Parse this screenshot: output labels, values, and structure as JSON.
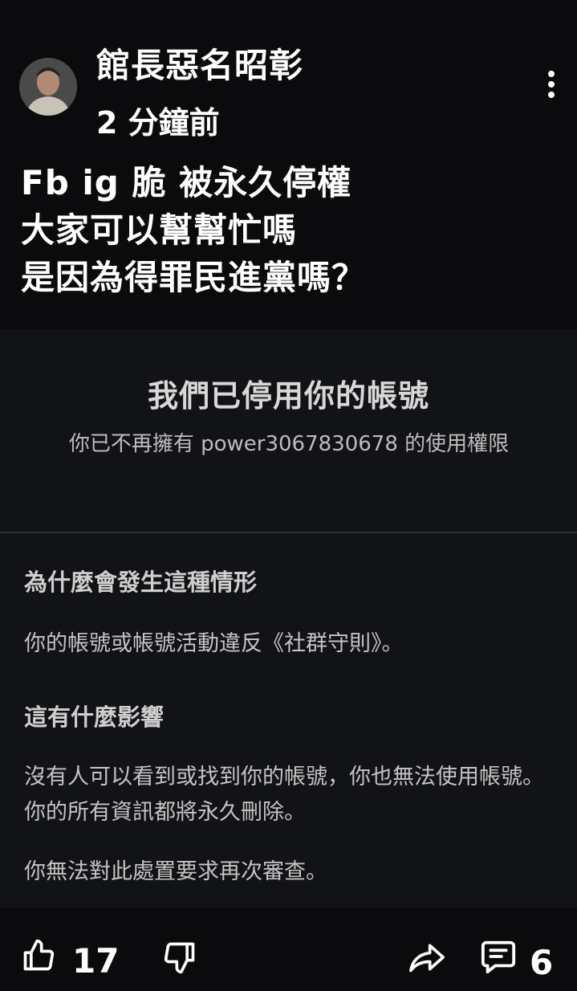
{
  "post": {
    "author": "館長惡名昭彰",
    "time": "2 分鐘前",
    "lines": [
      "Fb ig 脆 被永久停權",
      "大家可以幫幫忙嗎",
      "是因為得罪民進黨嗎？"
    ]
  },
  "embed": {
    "title": "我們已停用你的帳號",
    "subtitle": "你已不再擁有 power3067830678 的使用權限",
    "section1_heading": "為什麼會發生這種情形",
    "section1_text": "你的帳號或帳號活動違反《社群守則》。",
    "section2_heading": "這有什麼影響",
    "section2_text": "沒有人可以看到或找到你的帳號，你也無法使用帳號。你的所有資訊都將永久刪除。",
    "section3_text": "你無法對此處置要求再次審查。"
  },
  "footer": {
    "upvote_count": "17",
    "comment_count": "6"
  },
  "icons": {
    "avatar": "avatar",
    "more": "more-vertical-icon",
    "upvote": "thumbs-up-icon",
    "downvote": "thumbs-down-icon",
    "share": "share-icon",
    "comment": "comment-icon"
  }
}
